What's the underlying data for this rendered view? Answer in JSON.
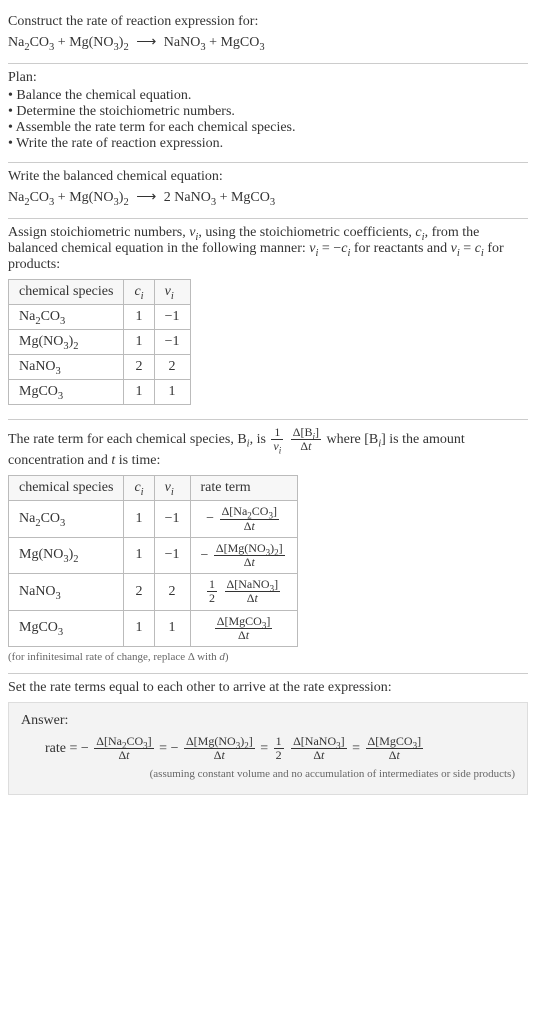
{
  "intro": {
    "prompt": "Construct the rate of reaction expression for:",
    "eq_lhs1": "Na",
    "eq_lhs1_sub": "2",
    "eq_lhs1b": "CO",
    "eq_lhs1b_sub": "3",
    "plus1": " + ",
    "eq_lhs2": "Mg(NO",
    "eq_lhs2_sub": "3",
    "eq_lhs2b": ")",
    "eq_lhs2b_sub": "2",
    "arrow": "⟶",
    "eq_rhs1": "NaNO",
    "eq_rhs1_sub": "3",
    "plus2": " + ",
    "eq_rhs2": "MgCO",
    "eq_rhs2_sub": "3"
  },
  "plan": {
    "title": "Plan:",
    "b1": "• Balance the chemical equation.",
    "b2": "• Determine the stoichiometric numbers.",
    "b3": "• Assemble the rate term for each chemical species.",
    "b4": "• Write the rate of reaction expression."
  },
  "balanced": {
    "prompt": "Write the balanced chemical equation:",
    "coef": "2 "
  },
  "stoich": {
    "text1": "Assign stoichiometric numbers, ",
    "nu": "ν",
    "sub_i": "i",
    "text2": ", using the stoichiometric coefficients, ",
    "c": "c",
    "text3": ", from the balanced chemical equation in the following manner: ",
    "eq1a": "ν",
    "eq1b": " = −",
    "eq1c": "c",
    "text4": " for reactants and ",
    "eq2a": "ν",
    "eq2b": " = ",
    "eq2c": "c",
    "text5": " for products:",
    "hdr_species": "chemical species",
    "hdr_c": "c",
    "hdr_nu": "ν",
    "r1_s": "Na",
    "r1_sub1": "2",
    "r1_s2": "CO",
    "r1_sub2": "3",
    "r1_c": "1",
    "r1_v": "−1",
    "r2_s": "Mg(NO",
    "r2_sub1": "3",
    "r2_s2": ")",
    "r2_sub2": "2",
    "r2_c": "1",
    "r2_v": "−1",
    "r3_s": "NaNO",
    "r3_sub1": "3",
    "r3_c": "2",
    "r3_v": "2",
    "r4_s": "MgCO",
    "r4_sub1": "3",
    "r4_c": "1",
    "r4_v": "1"
  },
  "rateterm": {
    "t1": "The rate term for each chemical species, B",
    "t2": ", is ",
    "one": "1",
    "nu": "ν",
    "sub_i": "i",
    "delta_b_num": "Δ[B",
    "delta_b_num2": "]",
    "delta_t": "Δt",
    "t3": " where [B",
    "t4": "] is the amount concentration and ",
    "t_var": "t",
    "t5": " is time:",
    "hdr_species": "chemical species",
    "hdr_c": "c",
    "hdr_nu": "ν",
    "hdr_rate": "rate term",
    "neg": "−",
    "r1_num": "Δ[Na",
    "r1_num_s1": "2",
    "r1_num2": "CO",
    "r1_num_s2": "3",
    "r1_num3": "]",
    "r2_num": "Δ[Mg(NO",
    "r2_num_s1": "3",
    "r2_num2": ")",
    "r2_num_s2": "2",
    "r2_num3": "]",
    "half_num": "1",
    "half_den": "2",
    "r3_num": "Δ[NaNO",
    "r3_num_s1": "3",
    "r3_num2": "]",
    "r4_num": "Δ[MgCO",
    "r4_num_s1": "3",
    "r4_num2": "]",
    "note": "(for infinitesimal rate of change, replace Δ with ",
    "note_d": "d",
    "note2": ")"
  },
  "final": {
    "prompt": "Set the rate terms equal to each other to arrive at the rate expression:"
  },
  "answer": {
    "title": "Answer:",
    "rate": "rate = −",
    "eq": " = −",
    "eq2": " = ",
    "note": "(assuming constant volume and no accumulation of intermediates or side products)"
  },
  "chart_data": {
    "type": "table",
    "tables": [
      {
        "columns": [
          "chemical species",
          "c_i",
          "ν_i"
        ],
        "rows": [
          [
            "Na2CO3",
            1,
            -1
          ],
          [
            "Mg(NO3)2",
            1,
            -1
          ],
          [
            "NaNO3",
            2,
            2
          ],
          [
            "MgCO3",
            1,
            1
          ]
        ]
      },
      {
        "columns": [
          "chemical species",
          "c_i",
          "ν_i",
          "rate term"
        ],
        "rows": [
          [
            "Na2CO3",
            1,
            -1,
            "-Δ[Na2CO3]/Δt"
          ],
          [
            "Mg(NO3)2",
            1,
            -1,
            "-Δ[Mg(NO3)2]/Δt"
          ],
          [
            "NaNO3",
            2,
            2,
            "(1/2) Δ[NaNO3]/Δt"
          ],
          [
            "MgCO3",
            1,
            1,
            "Δ[MgCO3]/Δt"
          ]
        ]
      }
    ],
    "balanced_equation": "Na2CO3 + Mg(NO3)2 ⟶ 2 NaNO3 + MgCO3",
    "rate_expression": "rate = -Δ[Na2CO3]/Δt = -Δ[Mg(NO3)2]/Δt = (1/2)Δ[NaNO3]/Δt = Δ[MgCO3]/Δt"
  }
}
